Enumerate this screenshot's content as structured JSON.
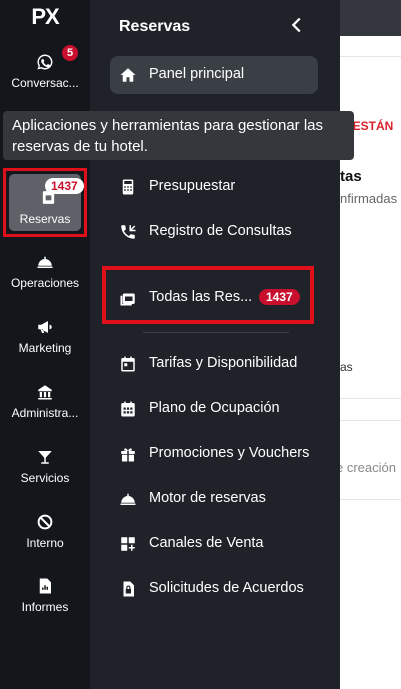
{
  "app": {
    "logo": "PX"
  },
  "rail": {
    "items": [
      {
        "label": "Conversac...",
        "icon": "whatsapp-icon",
        "badge": "5"
      },
      {
        "label": "Reservas",
        "icon": "reservations-icon",
        "badge": "1437",
        "active": true
      },
      {
        "label": "Operaciones",
        "icon": "service-bell-icon"
      },
      {
        "label": "Marketing",
        "icon": "megaphone-icon"
      },
      {
        "label": "Administra...",
        "icon": "building-icon"
      },
      {
        "label": "Servicios",
        "icon": "cocktail-icon"
      },
      {
        "label": "Interno",
        "icon": "ban-icon"
      },
      {
        "label": "Informes",
        "icon": "report-icon"
      }
    ]
  },
  "panel": {
    "title": "Reservas",
    "items": [
      {
        "label": "Panel principal",
        "icon": "home-icon",
        "active": true
      },
      {
        "label": "Presupuestar",
        "icon": "calculator-icon"
      },
      {
        "label": "Registro de Consultas",
        "icon": "phone-callback-icon"
      },
      {
        "label": "Todas las Res...",
        "icon": "calendar-list-icon",
        "badge": "1437"
      },
      {
        "label": "Tarifas y Disponibilidad",
        "icon": "calendar-icon"
      },
      {
        "label": "Plano de Ocupación",
        "icon": "calendar-grid-icon"
      },
      {
        "label": "Promociones y Vouchers",
        "icon": "gift-icon"
      },
      {
        "label": "Motor de reservas",
        "icon": "service-bell-icon"
      },
      {
        "label": "Canales de Venta",
        "icon": "grid-plus-icon"
      },
      {
        "label": "Solicitudes de Acuerdos",
        "icon": "document-lock-icon"
      }
    ]
  },
  "tooltip": {
    "text": "Aplicaciones y herramientas para gestionar las reservas de tu hotel."
  },
  "content": {
    "alert": "O ESTÁN",
    "heading": "tas",
    "subheading": "nfirmadas",
    "note": "as",
    "date_hint": "e creación"
  },
  "colors": {
    "accent_red": "#e0101a",
    "badge_red": "#c8102e",
    "sidebar_bg": "#13161b",
    "panel_bg": "#1f2228"
  }
}
